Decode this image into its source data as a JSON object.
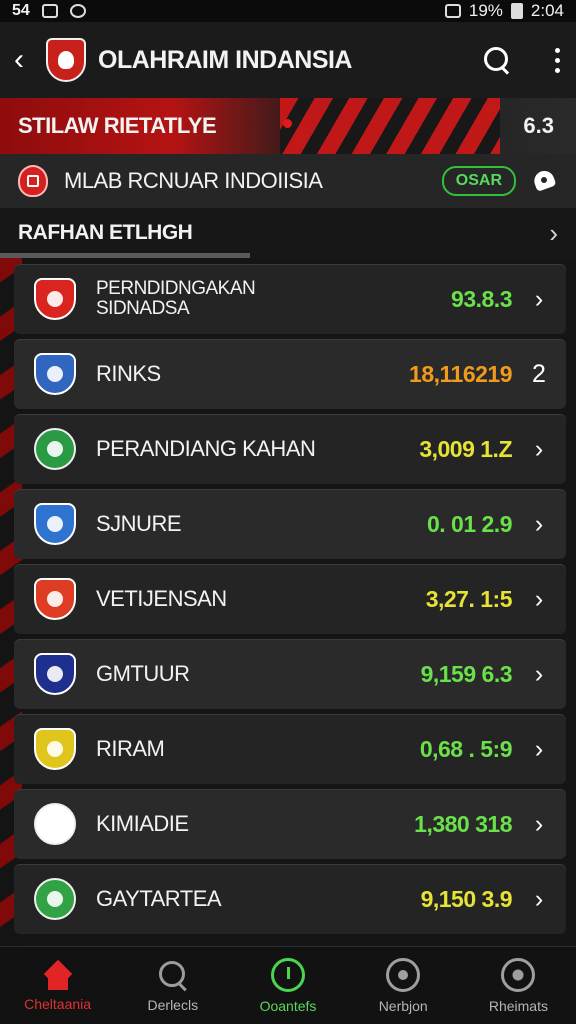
{
  "status": {
    "left": "54",
    "battery": "19%",
    "time": "2:04"
  },
  "app": {
    "title": "OLAHRAIM INDANSIA"
  },
  "banner": {
    "title": "STILAW RIETATLYE",
    "value": "6.3"
  },
  "league": {
    "title": "MLAB RCNUAR INDOIISIA",
    "pill": "OSAR"
  },
  "section": {
    "title": "RAFHAN ETLHGH"
  },
  "teams": [
    {
      "name": "PERNDIDNGAKAN\nSIDNADSA",
      "score": "93.8.3",
      "color": "green",
      "badge_color": "#d9241f",
      "shape": "shield",
      "chevron": "›"
    },
    {
      "name": "RINKS",
      "score": "18,116219",
      "color": "orange",
      "badge_color": "#3066bf",
      "shape": "shield",
      "chevron": "2"
    },
    {
      "name": "PERANDIANG KAHAN",
      "score": "3,009 1.Z",
      "color": "yellow",
      "badge_color": "#2b9a45",
      "shape": "round",
      "chevron": "›"
    },
    {
      "name": "SJNURE",
      "score": "0. 01 2.9",
      "color": "green",
      "badge_color": "#2f73d1",
      "shape": "shield",
      "chevron": "›"
    },
    {
      "name": "VETIJENSAN",
      "score": "3,27. 1:5",
      "color": "yellow",
      "badge_color": "#df3d23",
      "shape": "shield",
      "chevron": "›"
    },
    {
      "name": "GMTUUR",
      "score": "9,159 6.3",
      "color": "green",
      "badge_color": "#1e2f8f",
      "shape": "shield",
      "chevron": "›"
    },
    {
      "name": "RIRAM",
      "score": "0,68 . 5:9",
      "color": "green",
      "badge_color": "#e0c51d",
      "shape": "shield",
      "chevron": "›"
    },
    {
      "name": "KIMIADIE",
      "score": "1,380 318",
      "color": "green",
      "badge_color": "#ffffff",
      "shape": "round",
      "chevron": "›"
    },
    {
      "name": "GAYTARTEA",
      "score": "9,150 3.9",
      "color": "yellow",
      "badge_color": "#31a344",
      "shape": "round",
      "chevron": "›"
    }
  ],
  "nav": [
    {
      "label": "Cheltaania",
      "icon": "home-icon",
      "state": "active"
    },
    {
      "label": "Derlecls",
      "icon": "search-icon",
      "state": "normal"
    },
    {
      "label": "Ooantefs",
      "icon": "clock-icon",
      "state": "green"
    },
    {
      "label": "Nerbjon",
      "icon": "gauge-icon",
      "state": "normal"
    },
    {
      "label": "Rheimats",
      "icon": "ball-icon",
      "state": "normal"
    }
  ]
}
